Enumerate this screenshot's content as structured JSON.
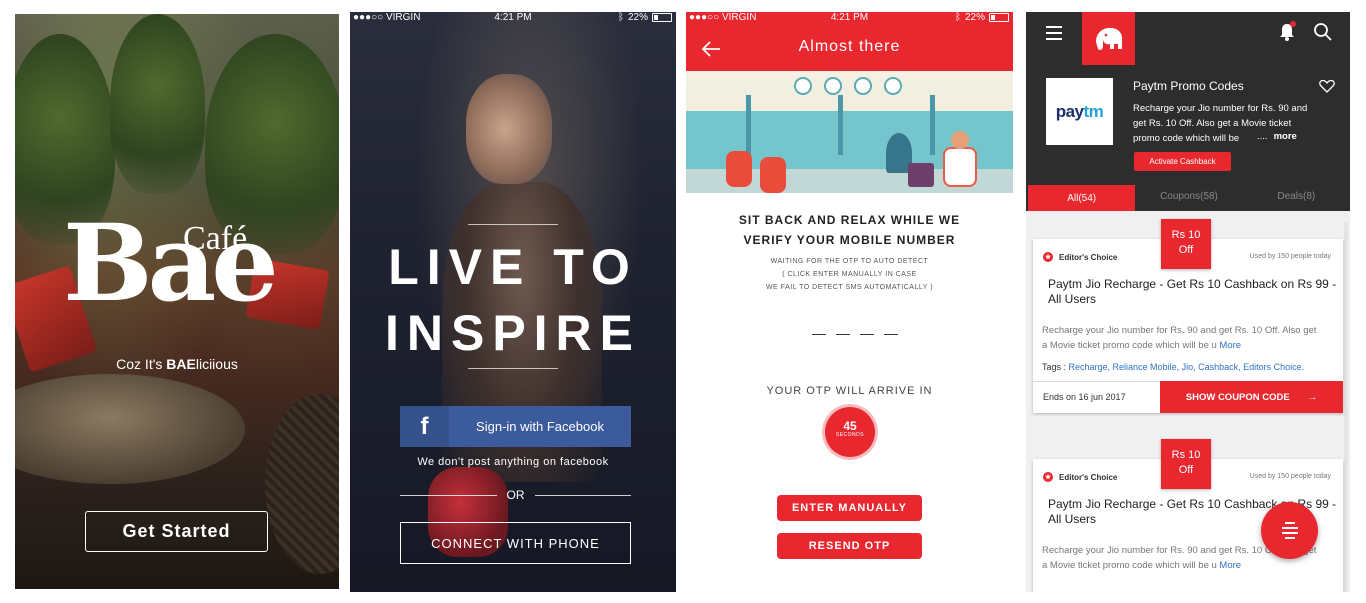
{
  "screen1": {
    "logo_top": "Café",
    "logo_main": "Bae",
    "tagline_prefix": "Coz It's ",
    "tagline_bold": "BAE",
    "tagline_suffix": "liciious",
    "get_started_label": "Get Started"
  },
  "screen2": {
    "status": {
      "carrier": "●●●○○ VIRGIN",
      "time": "4:21 PM",
      "battery": "22%"
    },
    "title_line1": "LIVE TO",
    "title_line2": "INSPIRE",
    "facebook_icon_glyph": "f",
    "facebook_label": "Sign-in with Facebook",
    "facebook_note": "We don't post anything on facebook",
    "or_label": "OR",
    "phone_label": "CONNECT WITH PHONE"
  },
  "screen3": {
    "status": {
      "carrier": "●●●○○ VIRGIN",
      "time": "4:21 PM",
      "battery": "22%"
    },
    "header_title": "Almost there",
    "headline_line1": "SIT BACK AND RELAX WHILE WE",
    "headline_line2": "VERIFY YOUR MOBILE NUMBER",
    "sub_line1": "WAITING FOR THE OTP TO AUTO DETECT",
    "sub_line2": "( CLICK ENTER MANUALLY IN CASE",
    "sub_line3": "WE FAIL TO DETECT SMS AUTOMATICALLY )",
    "otp_arrive_label": "YOUR OTP WILL ARRIVE IN",
    "timer_value": "45",
    "timer_unit": "SECONDS",
    "enter_manually_label": "ENTER MANUALLY",
    "resend_label": "RESEND OTP"
  },
  "screen4": {
    "brand_pay": "pay",
    "brand_tm": "tm",
    "hero_title": "Paytm Promo Codes",
    "hero_desc": "Recharge your Jio number for Rs. 90 and get Rs. 10 Off. Also get a Movie ticket promo code which will be",
    "hero_ellipsis": "....",
    "hero_more": "more",
    "activate_label": "Activate Cashback",
    "tabs": [
      {
        "label": "All(54)"
      },
      {
        "label": "Coupons(58)"
      },
      {
        "label": "Deals(8)"
      }
    ],
    "cards": [
      {
        "badge_line1": "Rs 10",
        "badge_line2": "Off",
        "editor_label": "Editor's Choice",
        "used_label": "Used by 150 people today",
        "title": "Paytm Jio Recharge - Get Rs 10 Cashback on Rs 99 - All Users",
        "desc": "Recharge your Jio number for Rs. 90 and get Rs. 10 Off. Also get a Movie ticket promo code which will be u",
        "more_label": "More",
        "tags_label": "Tags : ",
        "tags": "Recharge, Reliance Mobile, Jio, Cashback, Editors Choice.",
        "ends": "Ends on 16 jun 2017",
        "show_code_label": "SHOW COUPON CODE",
        "arrow": "→"
      },
      {
        "badge_line1": "Rs 10",
        "badge_line2": "Off",
        "editor_label": "Editor's Choice",
        "used_label": "Used by 150 people today",
        "title": "Paytm Jio Recharge - Get Rs 10 Cashback on Rs 99 - All Users",
        "desc": "Recharge your Jio number for Rs. 90 and get Rs. 10 Off. Also get a Movie ticket promo code which will be u",
        "more_label": "More"
      }
    ],
    "colors": {
      "accent": "#e8272f",
      "dark": "#2e2d2d",
      "link": "#2f72c4"
    }
  }
}
